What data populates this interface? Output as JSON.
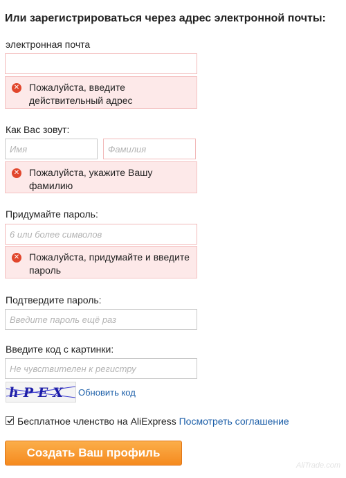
{
  "heading": "Или зарегистрироваться через адрес электронной почты:",
  "email": {
    "label": "электронная почта",
    "value": "",
    "placeholder": "",
    "error": "Пожалуйста, введите действительный адрес"
  },
  "name": {
    "label": "Как Вас зовут:",
    "first_placeholder": "Имя",
    "last_placeholder": "Фамилия",
    "error": "Пожалуйста, укажите Вашу фамилию"
  },
  "password": {
    "label": "Придумайте пароль:",
    "placeholder": "6 или более символов",
    "error": "Пожалуйста, придумайте и введите пароль"
  },
  "confirm": {
    "label": "Подтвердите пароль:",
    "placeholder": "Введите пароль ещё раз"
  },
  "captcha": {
    "label": "Введите код с картинки:",
    "placeholder": "Не чувствителен к регистру",
    "image_text": "hPEX",
    "refresh_label": "Обновить код"
  },
  "agreement": {
    "checked": true,
    "text": "Бесплатное членство на AliExpress",
    "link": "Посмотреть соглашение"
  },
  "submit_label": "Создать Ваш профиль",
  "watermark": "AliTrade.com",
  "icons": {
    "error": "error-x-icon",
    "checkbox": "checkmark-icon"
  },
  "colors": {
    "accent": "#f58a1f",
    "link": "#1b5ea8",
    "error_bg": "#fde9e9",
    "error_icon": "#e1462c"
  }
}
